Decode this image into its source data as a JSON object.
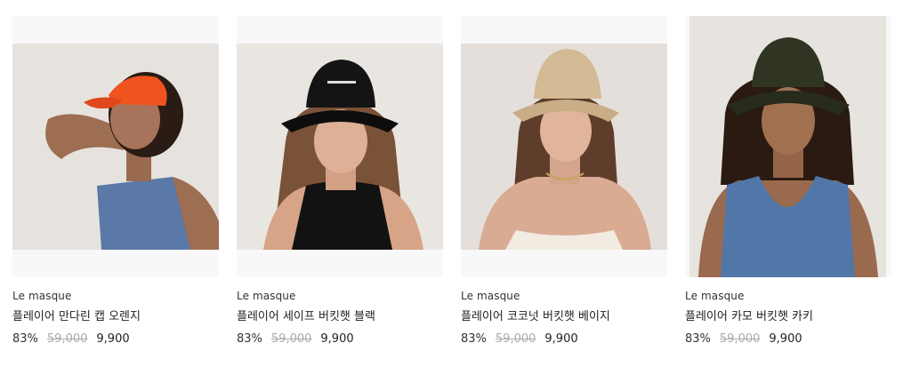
{
  "products": [
    {
      "brand": "Le masque",
      "name": "플레이어 만다린 캡 오렌지",
      "discount": "83%",
      "original_price": "59,000",
      "sale_price": "9,900",
      "image": "model-orange-cap",
      "hat_color": "#f0531f"
    },
    {
      "brand": "Le masque",
      "name": "플레이어 세이프 버킷햇 블랙",
      "discount": "83%",
      "original_price": "59,000",
      "sale_price": "9,900",
      "image": "model-black-bucket-hat",
      "hat_color": "#141414"
    },
    {
      "brand": "Le masque",
      "name": "플레이어 코코넛 버킷햇 베이지",
      "discount": "83%",
      "original_price": "59,000",
      "sale_price": "9,900",
      "image": "model-beige-bucket-hat",
      "hat_color": "#d3b994"
    },
    {
      "brand": "Le masque",
      "name": "플레이어 카모 버킷햇 카키",
      "discount": "83%",
      "original_price": "59,000",
      "sale_price": "9,900",
      "image": "model-khaki-bucket-hat",
      "hat_color": "#2f3522"
    }
  ]
}
